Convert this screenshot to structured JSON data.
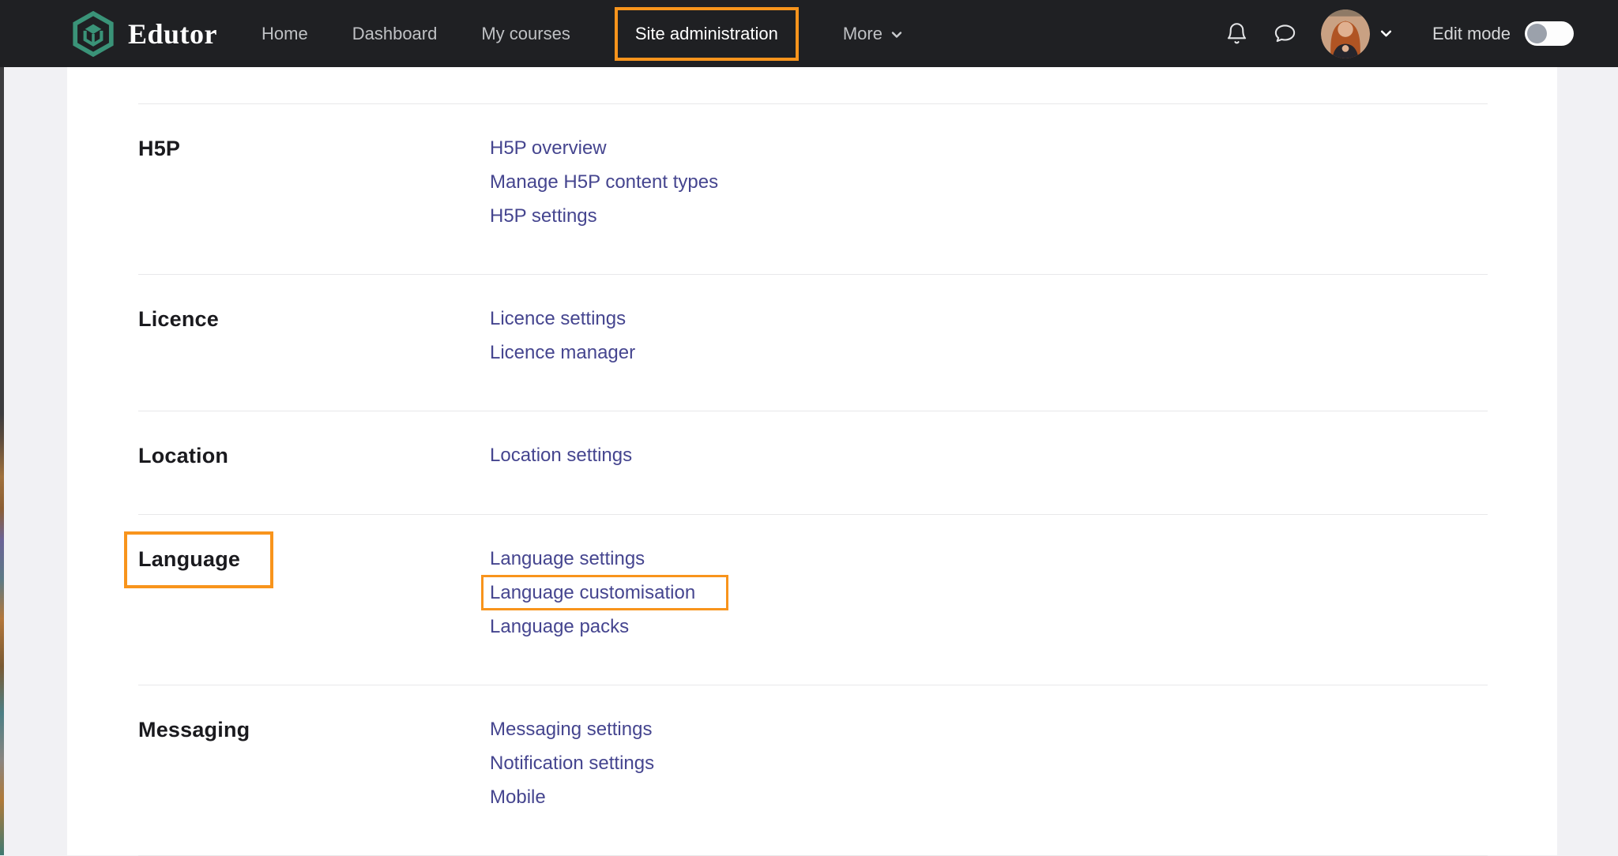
{
  "brand": {
    "name": "Edutor"
  },
  "navbar": {
    "items": [
      {
        "label": "Home",
        "active": false,
        "highlighted": false
      },
      {
        "label": "Dashboard",
        "active": false,
        "highlighted": false
      },
      {
        "label": "My courses",
        "active": false,
        "highlighted": false
      },
      {
        "label": "Site administration",
        "active": true,
        "highlighted": true
      },
      {
        "label": "More",
        "active": false,
        "highlighted": false,
        "dropdown": true
      }
    ],
    "edit_mode": {
      "label": "Edit mode",
      "enabled": false
    }
  },
  "icons": {
    "logo": "hexagon-cube-logo",
    "notifications": "bell",
    "messages": "speech-bubble",
    "user_menu": "chevron-down",
    "more_menu": "chevron-down"
  },
  "settings_sections": [
    {
      "heading": "H5P",
      "heading_highlighted": false,
      "links": [
        {
          "label": "H5P overview",
          "highlighted": false
        },
        {
          "label": "Manage H5P content types",
          "highlighted": false
        },
        {
          "label": "H5P settings",
          "highlighted": false
        }
      ]
    },
    {
      "heading": "Licence",
      "heading_highlighted": false,
      "links": [
        {
          "label": "Licence settings",
          "highlighted": false
        },
        {
          "label": "Licence manager",
          "highlighted": false
        }
      ]
    },
    {
      "heading": "Location",
      "heading_highlighted": false,
      "links": [
        {
          "label": "Location settings",
          "highlighted": false
        }
      ]
    },
    {
      "heading": "Language",
      "heading_highlighted": true,
      "links": [
        {
          "label": "Language settings",
          "highlighted": false
        },
        {
          "label": "Language customisation",
          "highlighted": true
        },
        {
          "label": "Language packs",
          "highlighted": false
        }
      ]
    },
    {
      "heading": "Messaging",
      "heading_highlighted": false,
      "links": [
        {
          "label": "Messaging settings",
          "highlighted": false
        },
        {
          "label": "Notification settings",
          "highlighted": false
        },
        {
          "label": "Mobile",
          "highlighted": false
        }
      ]
    }
  ],
  "colors": {
    "highlight_orange": "#F8941C",
    "link": "#45458F",
    "navbar_bg": "#1F2023",
    "logo_green": "#3A9378",
    "heading_text": "#1A1A1E",
    "divider": "#E8E8EA",
    "gutter_bg": "#F1F1F4"
  }
}
